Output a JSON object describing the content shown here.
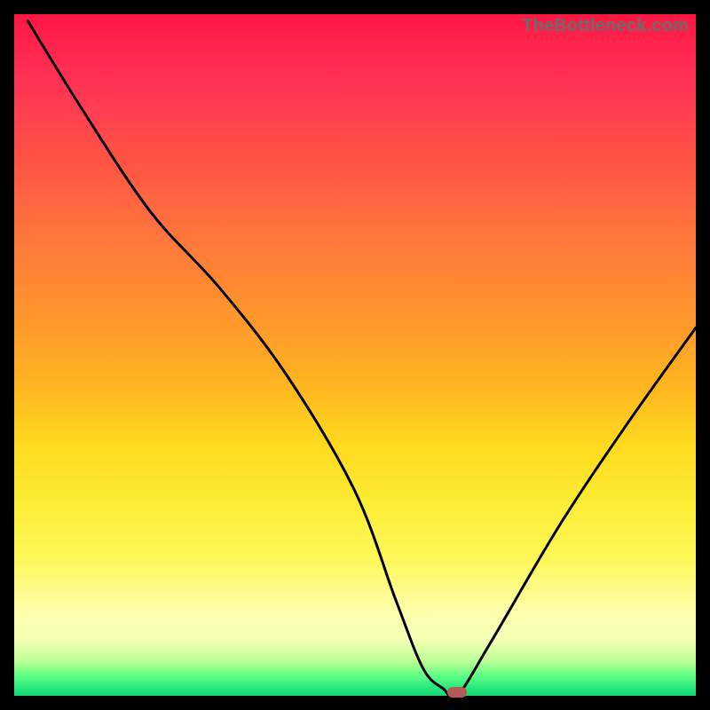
{
  "watermark": "TheBottleneck.com",
  "chart_data": {
    "type": "line",
    "title": "",
    "xlabel": "",
    "ylabel": "",
    "xlim": [
      0,
      100
    ],
    "ylim": [
      0,
      100
    ],
    "grid": false,
    "legend": false,
    "series": [
      {
        "name": "bottleneck-curve",
        "x": [
          2,
          10,
          20,
          30,
          40,
          50,
          56,
          60,
          63,
          65,
          70,
          80,
          90,
          100
        ],
        "values": [
          99,
          86,
          71,
          60,
          47,
          30,
          14,
          4,
          1,
          0,
          8,
          25,
          40,
          54
        ]
      }
    ],
    "annotations": [
      {
        "name": "optimal-marker",
        "x": 65,
        "y": 0.5,
        "color": "#b55a5a"
      }
    ],
    "background_gradient": {
      "top_color": "#ff1744",
      "bottom_color": "#18d674"
    }
  }
}
